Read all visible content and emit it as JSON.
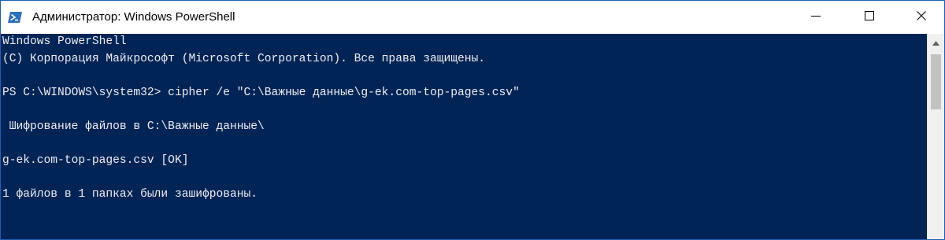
{
  "window": {
    "title": "Администратор: Windows PowerShell",
    "icon": "powershell-icon",
    "controls": {
      "minimize_icon": "minimize-icon",
      "maximize_icon": "maximize-icon",
      "close_icon": "close-icon"
    }
  },
  "console": {
    "background": "#012456",
    "foreground": "#eeedf0",
    "lines": [
      "Windows PowerShell",
      "(C) Корпорация Майкрософт (Microsoft Corporation). Все права защищены.",
      "",
      "PS C:\\WINDOWS\\system32> cipher /e \"C:\\Важные данные\\g-ek.com-top-pages.csv\"",
      "",
      " Шифрование файлов в C:\\Важные данные\\",
      "",
      "g-ek.com-top-pages.csv [OK]",
      "",
      "1 файлов в 1 папках были зашифрованы."
    ]
  },
  "scrollbar": {
    "up_icon": "scroll-up-arrow-icon"
  }
}
